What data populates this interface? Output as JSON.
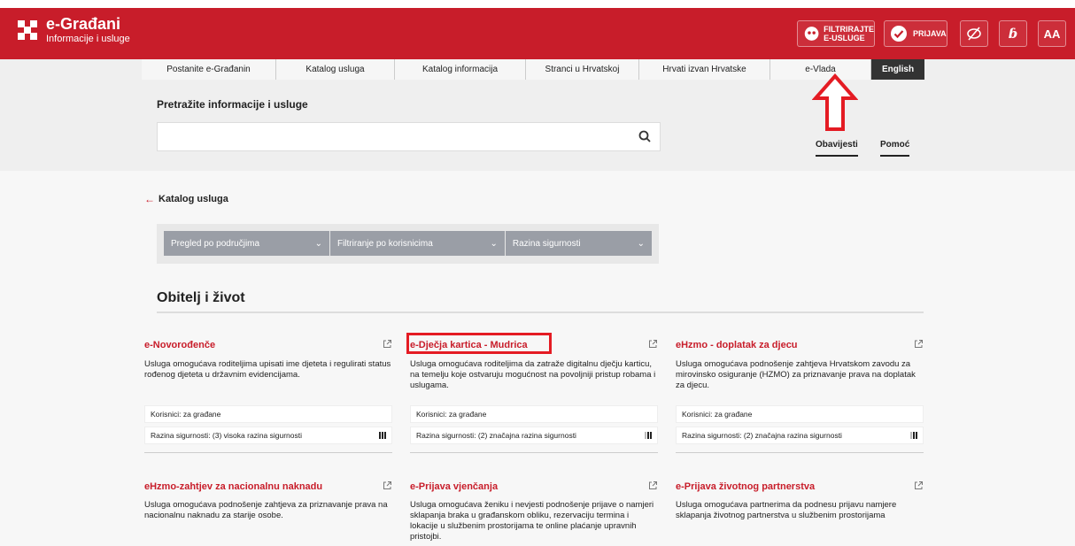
{
  "header": {
    "title": "e-Građani",
    "subtitle": "Informacije i usluge",
    "filter_button_line1": "FILTRIRAJTE",
    "filter_button_line2": "E-USLUGE",
    "login_label": "PRIJAVA",
    "font_label": "AA",
    "accent_color": "#c81d2a"
  },
  "nav": {
    "items": [
      "Postanite e-Građanin",
      "Katalog usluga",
      "Katalog informacija",
      "Stranci u Hrvatskoj",
      "Hrvati izvan Hrvatske",
      "e-Vlada",
      "English"
    ]
  },
  "search": {
    "label": "Pretražite informacije i usluge",
    "placeholder": ""
  },
  "tabs": {
    "notices": "Obavijesti",
    "help": "Pomoć"
  },
  "breadcrumb": {
    "label": "Katalog usluga"
  },
  "filters": [
    "Pregled po područjima",
    "Filtriranje po korisnicima",
    "Razina sigurnosti"
  ],
  "section": {
    "title": "Obitelj i život"
  },
  "cards": [
    {
      "title": "e-Novorođenče",
      "desc": "Usluga omogućava roditeljima upisati ime djeteta i regulirati status rođenog djeteta u državnim evidencijama.",
      "users": "Korisnici: za građane",
      "security": "Razina sigurnosti: (3) visoka razina sigurnosti",
      "level": 3
    },
    {
      "title": "e-Dječja kartica - Mudrica",
      "desc": "Usluga omogućava roditeljima da zatraže digitalnu dječju karticu, na temelju koje ostvaruju mogućnost na povoljniji pristup robama i uslugama.",
      "users": "Korisnici: za građane",
      "security": "Razina sigurnosti: (2) značajna razina sigurnosti",
      "level": 2
    },
    {
      "title": "eHzmo - doplatak za djecu",
      "desc": "Usluga omogućava podnošenje zahtjeva Hrvatskom zavodu za mirovinsko osiguranje (HZMO) za priznavanje prava na doplatak za djecu.",
      "users": "Korisnici: za građane",
      "security": "Razina sigurnosti: (2) značajna razina sigurnosti",
      "level": 2
    },
    {
      "title": "eHzmo-zahtjev za nacionalnu naknadu",
      "desc": "Usluga omogućava podnošenje zahtjeva za priznavanje prava na nacionalnu naknadu za starije osobe."
    },
    {
      "title": "e-Prijava vjenčanja",
      "desc": "Usluga omogućava ženiku i nevjesti podnošenje prijave o namjeri sklapanja braka u građanskom obliku, rezervaciju termina i lokacije u službenim prostorijama te online plaćanje upravnih pristojbi."
    },
    {
      "title": "e-Prijava životnog partnerstva",
      "desc": "Usluga omogućava partnerima da podnesu prijavu namjere sklapanja životnog partnerstva u službenim prostorijama"
    }
  ]
}
